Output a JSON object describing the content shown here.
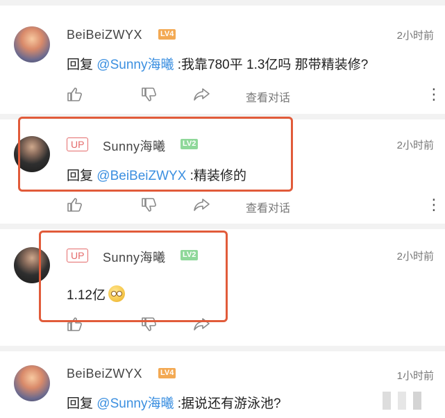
{
  "comments": [
    {
      "username": "BeiBeiZWYX",
      "level": "LV4",
      "time": "2小时前",
      "reply_prefix": "回复",
      "mention": "@Sunny海曦",
      "text": " :我靠780平 1.3亿吗 那带精装修?",
      "thread_label": "查看对话",
      "avatar": "sunset-avatar"
    },
    {
      "up_badge": "UP",
      "username": "Sunny海曦",
      "level": "LV2",
      "time": "2小时前",
      "reply_prefix": "回复",
      "mention": "@BeiBeiZWYX",
      "text": " :精装修的",
      "thread_label": "查看对话",
      "avatar": "person-avatar"
    },
    {
      "up_badge": "UP",
      "username": "Sunny海曦",
      "level": "LV2",
      "time": "2小时前",
      "text": "1.12亿",
      "emoji": "smile-emoji",
      "avatar": "person-avatar"
    },
    {
      "username": "BeiBeiZWYX",
      "level": "LV4",
      "time": "1小时前",
      "reply_prefix": "回复",
      "mention": "@Sunny海曦",
      "text": " :据说还有游泳池?",
      "avatar": "sunset-avatar"
    }
  ],
  "icons": {
    "like": "thumbs-up-icon",
    "dislike": "thumbs-down-icon",
    "share": "share-icon",
    "more": "more-vertical-icon"
  },
  "colors": {
    "mention": "#3b8fe0",
    "highlight": "#e15b3a",
    "up_badge": "#e46a6a",
    "lv4": "#f3a953",
    "lv2": "#8fd89a"
  }
}
